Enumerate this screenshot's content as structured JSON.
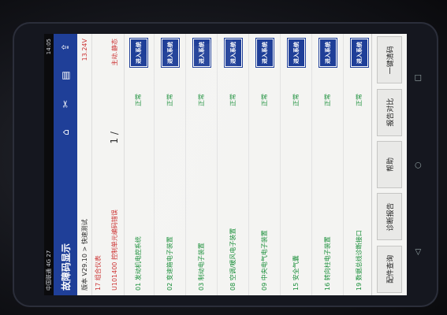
{
  "status_bar": {
    "carrier": "中国联通 4G 27",
    "right": "13.24V",
    "time": "14:05"
  },
  "app_bar": {
    "title": "故障码显示",
    "icons": [
      "home-icon",
      "tools-icon",
      "print-icon",
      "share-icon"
    ]
  },
  "sub_header": {
    "version": "版本 V29.10 > 快速测试",
    "battery": "13.24V",
    "group": "17 组合仪表",
    "warning": "U101400 控制单元编码错误",
    "pager": "1 /",
    "mode": "主动.静态"
  },
  "rows": [
    {
      "name": "01 发动机电控系统",
      "status": "正常",
      "button": "进入系统"
    },
    {
      "name": "02 变速箱电子装置",
      "status": "正常",
      "button": "进入系统"
    },
    {
      "name": "03 制动电子装置",
      "status": "正常",
      "button": "进入系统"
    },
    {
      "name": "08 空调/暖风电子装置",
      "status": "正常",
      "button": "进入系统"
    },
    {
      "name": "09 中央电气电子装置",
      "status": "正常",
      "button": "进入系统"
    },
    {
      "name": "15 安全气囊",
      "status": "正常",
      "button": "进入系统"
    },
    {
      "name": "16 转向柱电子装置",
      "status": "正常",
      "button": "进入系统"
    },
    {
      "name": "19 数据总线诊断接口",
      "status": "正常",
      "button": "进入系统"
    }
  ],
  "bottom_buttons": [
    "配件查询",
    "诊断报告",
    "帮助",
    "报告对比",
    "一键清码"
  ],
  "nav_bar": [
    "back-icon",
    "home-circle-icon",
    "recent-apps-icon"
  ]
}
